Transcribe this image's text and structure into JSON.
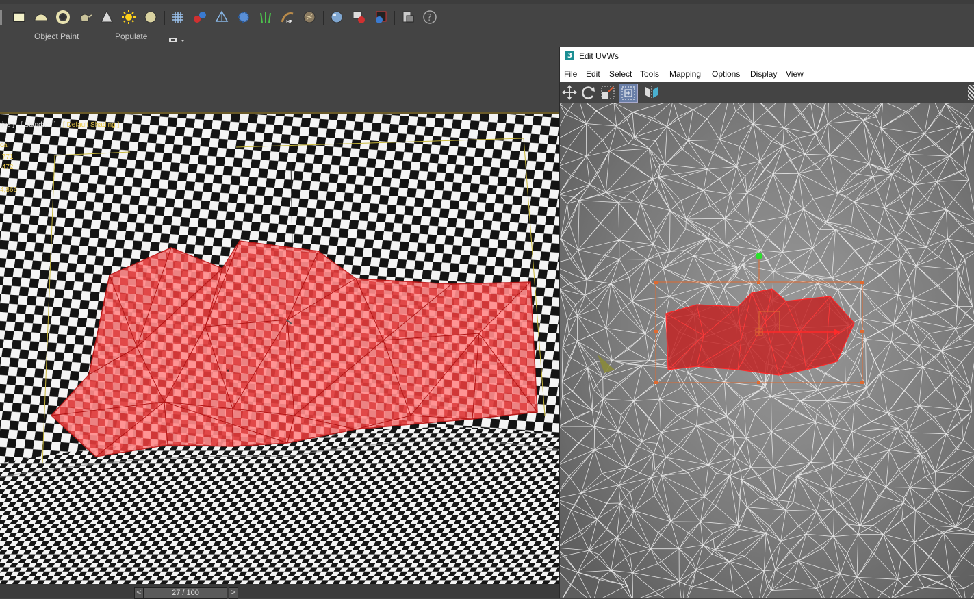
{
  "ribbon": {
    "tabs": [
      "Object Paint",
      "Populate"
    ]
  },
  "viewport": {
    "label_prefix": "tive ] ",
    "label_standard": "[ Standard ]",
    "label_shading": "[ Default Shading ]",
    "stats": [
      "cal",
      ",771",
      ",472",
      "4,866"
    ]
  },
  "timeline": {
    "frame_display": "27 / 100",
    "prev_label": "<",
    "next_label": ">"
  },
  "uvw_editor": {
    "app_icon_text": "3",
    "title": "Edit UVWs",
    "menu": [
      "File",
      "Edit",
      "Select",
      "Tools",
      "Mapping",
      "Options",
      "Display",
      "View"
    ]
  },
  "colors": {
    "selection_red": "#ff3b3b",
    "selection_fill": "#ff6b6b",
    "gizmo_orange": "#e06a30",
    "gizmo_green": "#2ce02c",
    "viewport_label_yellow": "#e8c84a",
    "panel_dark": "#444444"
  },
  "icons": {
    "toolbar": [
      "plane-icon",
      "sphere-half-icon",
      "ring-icon",
      "teapot-icon",
      "cone-icon",
      "sun-light-icon",
      "sphere-icon",
      "grid-icon",
      "molecule-icon",
      "prism-icon",
      "gear-icon",
      "grass-icon",
      "hair-fur-icon",
      "texture-icon",
      "sphere-render-icon",
      "render-setup-icon",
      "render-frame-icon",
      "material-editor-icon",
      "help-icon"
    ],
    "ribbon_dropdown": "chevron-down-icon",
    "uvw_toolbar": [
      "move-icon",
      "rotate-icon",
      "scale-icon",
      "freeform-icon",
      "mirror-icon"
    ]
  }
}
